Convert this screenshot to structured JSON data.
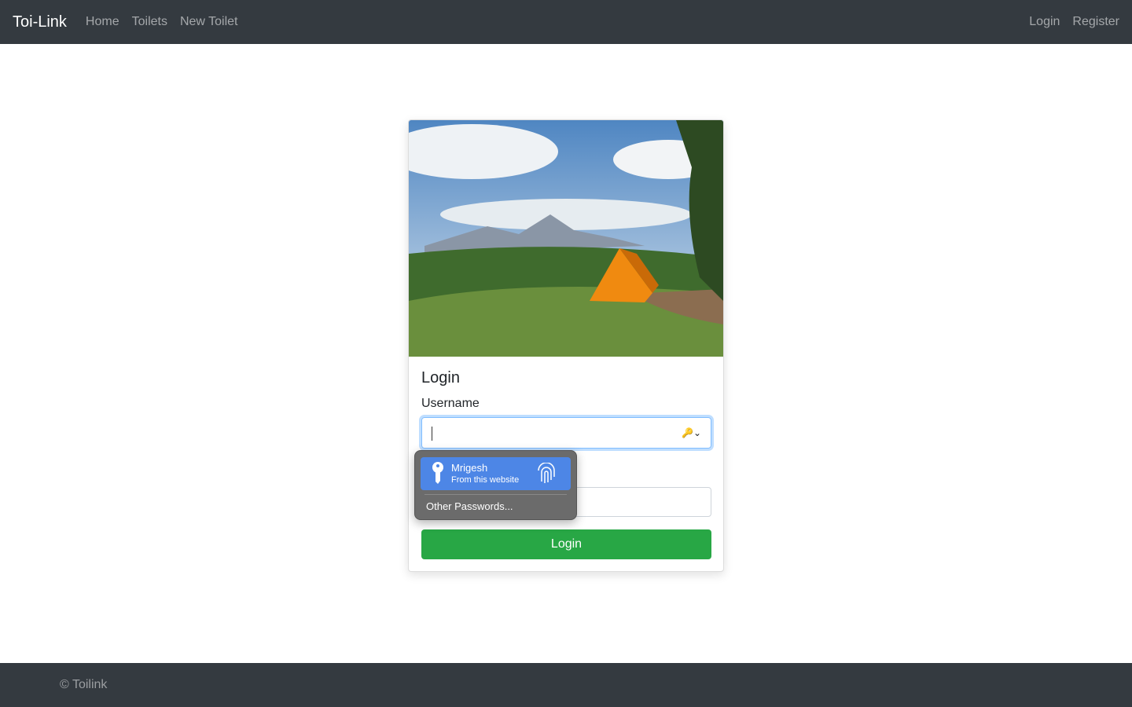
{
  "navbar": {
    "brand": "Toi-Link",
    "links": [
      "Home",
      "Toilets",
      "New Toilet"
    ],
    "right_links": [
      "Login",
      "Register"
    ]
  },
  "card": {
    "title": "Login",
    "username_label": "Username",
    "username_value": "",
    "submit_label": "Login"
  },
  "autofill": {
    "account": "Mrigesh",
    "source": "From this website",
    "other": "Other Passwords...",
    "accent": "#4d86e6"
  },
  "footer": {
    "text": "© Toilink"
  }
}
